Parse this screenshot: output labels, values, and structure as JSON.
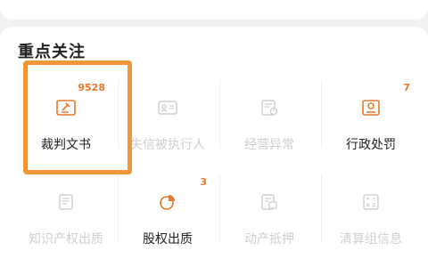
{
  "section": {
    "title": "重点关注"
  },
  "items": [
    {
      "label": "裁判文书",
      "count": "9528",
      "icon": "gavel-doc-icon",
      "active": true
    },
    {
      "label": "失信被执行人",
      "count": "",
      "icon": "id-card-icon",
      "active": false
    },
    {
      "label": "经营异常",
      "count": "",
      "icon": "alert-doc-icon",
      "active": false
    },
    {
      "label": "行政处罚",
      "count": "7",
      "icon": "penalty-badge-icon",
      "active": true
    },
    {
      "label": "知识产权出质",
      "count": "",
      "icon": "document-icon",
      "active": false
    },
    {
      "label": "股权出质",
      "count": "3",
      "icon": "pie-chart-icon",
      "active": true
    },
    {
      "label": "动产抵押",
      "count": "",
      "icon": "mortgage-doc-icon",
      "active": false
    },
    {
      "label": "清算组信息",
      "count": "",
      "icon": "calc-doc-icon",
      "active": false
    }
  ],
  "colors": {
    "accent": "#e8772e",
    "highlight": "#f0963a",
    "active_icon": "#e8772e",
    "inactive": "#cfcfcf"
  }
}
